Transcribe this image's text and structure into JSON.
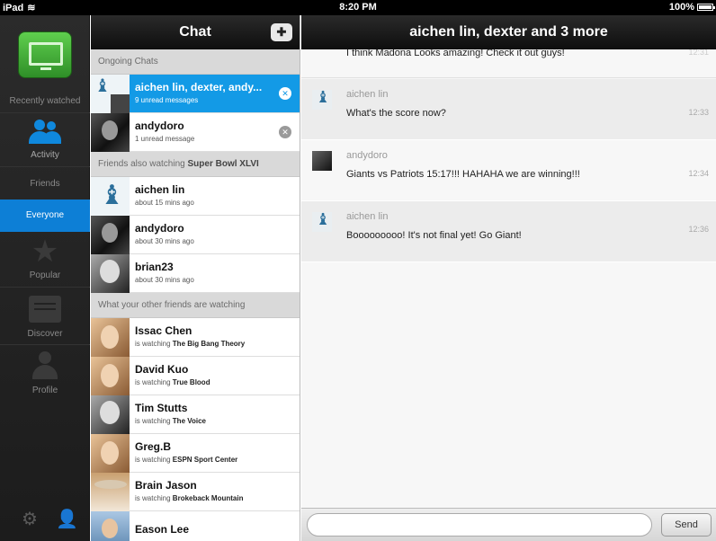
{
  "status_bar": {
    "device": "iPad",
    "time": "8:20 PM",
    "battery": "100%"
  },
  "left_nav": {
    "recently_watched": "Recently watched",
    "activity": "Activity",
    "friends": "Friends",
    "everyone": "Everyone",
    "popular": "Popular",
    "discover": "Discover",
    "profile": "Profile"
  },
  "chat_list": {
    "title": "Chat",
    "ongoing_header": "Ongoing Chats",
    "ongoing": [
      {
        "name": "aichen lin, dexter, andy...",
        "sub": "9 unread messages"
      },
      {
        "name": "andydoro",
        "sub": "1 unread message"
      }
    ],
    "also_watching_prefix": "Friends also watching ",
    "also_watching_show": "Super Bowl XLVI",
    "also_watching": [
      {
        "name": "aichen lin",
        "sub": "about 15 mins ago"
      },
      {
        "name": "andydoro",
        "sub": "about 30 mins ago"
      },
      {
        "name": "brian23",
        "sub": "about 30 mins ago"
      }
    ],
    "other_header": "What your other friends are watching",
    "watching_prefix": "is watching ",
    "other": [
      {
        "name": "Issac Chen",
        "show": "The Big Bang Theory"
      },
      {
        "name": "David Kuo",
        "show": "True Blood"
      },
      {
        "name": "Tim Stutts",
        "show": "The Voice"
      },
      {
        "name": "Greg.B",
        "show": "ESPN Sport Center"
      },
      {
        "name": "Brain Jason",
        "show": "Brokeback Mountain"
      },
      {
        "name": "Eason Lee",
        "show": ""
      }
    ]
  },
  "conversation": {
    "title": "aichen lin, dexter and 3 more",
    "first_partial": {
      "text": "I think Madona Looks amazing! Check it out guys!",
      "time": "12:31"
    },
    "messages": [
      {
        "sender": "aichen lin",
        "text": "What's the score now?",
        "time": "12:33"
      },
      {
        "sender": "andydoro",
        "text": "Giants vs Patriots 15:17!!! HAHAHA we are winning!!!",
        "time": "12:34"
      },
      {
        "sender": "aichen lin",
        "text": "Booooooooo! It's not final yet! Go Giant!",
        "time": "12:36"
      }
    ],
    "input_placeholder": "",
    "send_label": "Send"
  }
}
